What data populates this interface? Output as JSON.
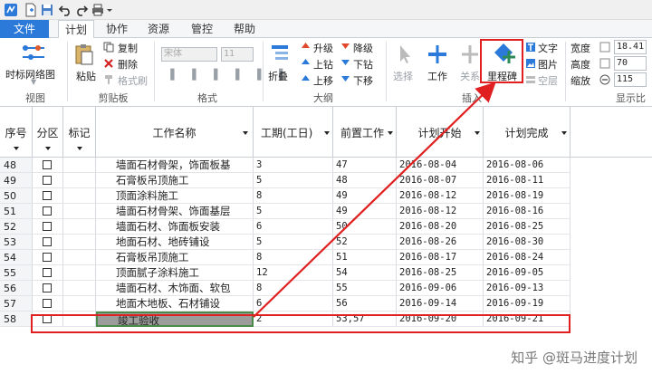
{
  "menu": {
    "file": "文件",
    "tabs": [
      "计划",
      "协作",
      "资源",
      "管控",
      "帮助"
    ]
  },
  "ribbon": {
    "view": {
      "timescale": "时标网络图",
      "group": "视图"
    },
    "clipboard": {
      "paste": "粘贴",
      "copy": "复制",
      "delete": "删除",
      "format_painter": "格式刷",
      "group": "剪贴板"
    },
    "format": {
      "font": "宋体",
      "size": "11",
      "group": "格式"
    },
    "outline": {
      "fold": "折叠",
      "upgrade": "升级",
      "downgrade": "降级",
      "move_up": "上钻",
      "move_down": "下钻",
      "shift_up": "上移",
      "shift_down": "下移",
      "group": "大纲"
    },
    "insert": {
      "select": "选择",
      "task": "工作",
      "relation": "关系",
      "milestone": "里程碑",
      "text": "文字",
      "picture": "图片",
      "spacer": "空层",
      "group": "插入"
    },
    "display": {
      "width_label": "宽度",
      "width": "18.41",
      "height_label": "高度",
      "height": "70",
      "zoom_label": "缩放",
      "zoom": "115",
      "group": "显示比"
    }
  },
  "grid": {
    "headers": {
      "seq": "序号",
      "zone": "分区",
      "mark": "标记",
      "name": "工作名称",
      "duration": "工期(工日)",
      "predecessor": "前置工作",
      "start": "计划开始",
      "finish": "计划完成"
    },
    "rows": [
      {
        "seq": "48",
        "name": "墙面石材骨架，饰面板基",
        "duration": "3",
        "pred": "47",
        "start": "2016-08-04",
        "finish": "2016-08-06"
      },
      {
        "seq": "49",
        "name": "石膏板吊顶施工",
        "duration": "5",
        "pred": "48",
        "start": "2016-08-07",
        "finish": "2016-08-11"
      },
      {
        "seq": "50",
        "name": "顶面涂料施工",
        "duration": "8",
        "pred": "49",
        "start": "2016-08-12",
        "finish": "2016-08-19"
      },
      {
        "seq": "51",
        "name": "墙面石材骨架、饰面基层",
        "duration": "5",
        "pred": "49",
        "start": "2016-08-12",
        "finish": "2016-08-16"
      },
      {
        "seq": "52",
        "name": "墙面石材、饰面板安装",
        "duration": "6",
        "pred": "50",
        "start": "2016-08-20",
        "finish": "2016-08-25"
      },
      {
        "seq": "53",
        "name": "地面石材、地砖铺设",
        "duration": "5",
        "pred": "52",
        "start": "2016-08-26",
        "finish": "2016-08-30"
      },
      {
        "seq": "54",
        "name": "石膏板吊顶施工",
        "duration": "8",
        "pred": "51",
        "start": "2016-08-17",
        "finish": "2016-08-24"
      },
      {
        "seq": "55",
        "name": "顶面腻子涂料施工",
        "duration": "12",
        "pred": "54",
        "start": "2016-08-25",
        "finish": "2016-09-05"
      },
      {
        "seq": "56",
        "name": "墙面石材、木饰面、软包",
        "duration": "8",
        "pred": "55",
        "start": "2016-09-06",
        "finish": "2016-09-13"
      },
      {
        "seq": "57",
        "name": "地面木地板、石材铺设",
        "duration": "6",
        "pred": "56",
        "start": "2016-09-14",
        "finish": "2016-09-19"
      },
      {
        "seq": "58",
        "name": "竣工验收",
        "duration": "2",
        "pred": "53,57",
        "start": "2016-09-20",
        "finish": "2016-09-21"
      }
    ]
  },
  "watermark": "知乎 @斑马进度计划",
  "colors": {
    "accent": "#2b79d8",
    "highlight": "#e02020",
    "selected_cell": "#9c9c9c"
  }
}
